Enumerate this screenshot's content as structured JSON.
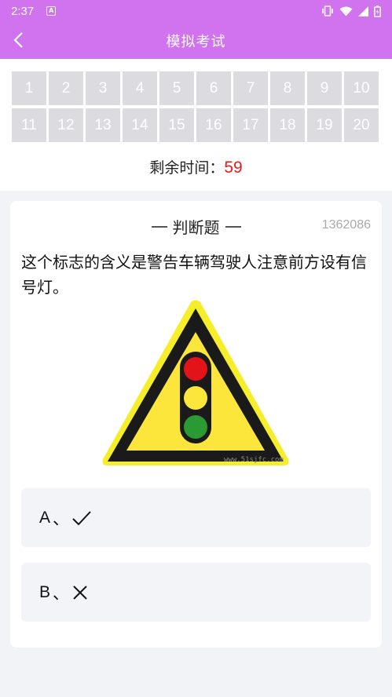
{
  "status_bar": {
    "time": "2:37",
    "icons": [
      "notification-a-icon",
      "vibrate-icon",
      "wifi-icon",
      "signal-icon",
      "battery-icon"
    ]
  },
  "header": {
    "title": "模拟考试",
    "back_icon": "chevron-left-icon"
  },
  "question_numbers": [
    "1",
    "2",
    "3",
    "4",
    "5",
    "6",
    "7",
    "8",
    "9",
    "10",
    "11",
    "12",
    "13",
    "14",
    "15",
    "16",
    "17",
    "18",
    "19",
    "20"
  ],
  "timer": {
    "label": "剩余时间：",
    "value": "59"
  },
  "question": {
    "type": "判断题",
    "id": "1362086",
    "text": "这个标志的含义是警告车辆驾驶人注意前方设有信号灯。",
    "image_watermark": "www.51sjfc.com"
  },
  "options": [
    {
      "letter": "A",
      "separator": "、",
      "mark": "check-icon"
    },
    {
      "letter": "B",
      "separator": "、",
      "mark": "cross-icon"
    }
  ],
  "colors": {
    "header_bg": "#d173ef",
    "cell_bg": "#dcdce0",
    "timer_value": "#e8191b",
    "sign_yellow": "#fde63b",
    "light_red": "#e2141a",
    "light_yellow": "#fde63b",
    "light_green": "#2b9a33"
  }
}
